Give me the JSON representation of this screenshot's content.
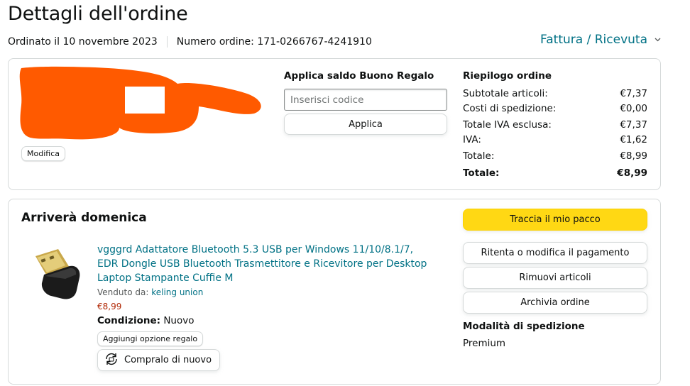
{
  "page": {
    "title": "Dettagli dell'ordine",
    "ordered_on": "Ordinato il 10 novembre 2023",
    "order_number": "Numero ordine: 171-0266767-4241910",
    "invoice_link": "Fattura / Ricevuta"
  },
  "address": {
    "edit_label": "Modifica"
  },
  "gift_card": {
    "title": "Applica saldo Buono Regalo",
    "input_placeholder": "Inserisci codice",
    "input_value": "",
    "apply_label": "Applica"
  },
  "summary": {
    "title": "Riepilogo ordine",
    "rows": [
      {
        "label": "Subtotale articoli:",
        "value": "€7,37"
      },
      {
        "label": "Costi di spedizione:",
        "value": "€0,00"
      },
      {
        "label": "Totale IVA esclusa:",
        "value": "€7,37"
      },
      {
        "label": "IVA:",
        "value": "€1,62"
      },
      {
        "label": "Totale:",
        "value": "€8,99"
      }
    ],
    "grand_total_label": "Totale:",
    "grand_total_value": "€8,99"
  },
  "shipment": {
    "title": "Arriverà domenica",
    "product": {
      "title": "vgggrd Adattatore Bluetooth 5.3 USB per Windows 11/10/8.1/7, EDR Dongle USB Bluetooth Trasmettitore e Ricevitore per Desktop Laptop Stampante Cuffie M",
      "seller_label": "Venduto da:",
      "seller_name": "keling union",
      "price": "€8,99",
      "condition_label": "Condizione:",
      "condition_value": "Nuovo",
      "gift_option_label": "Aggiungi opzione regalo",
      "buy_again_label": "Compralo di nuovo"
    },
    "actions": {
      "track": "Traccia il mio pacco",
      "retry_payment": "Ritenta o modifica il pagamento",
      "remove_items": "Rimuovi articoli",
      "archive": "Archivia ordine"
    },
    "shipping_method_title": "Modalità di spedizione",
    "shipping_method_value": "Premium"
  },
  "colors": {
    "link": "#007185",
    "primary_button": "#ffd814",
    "price": "#b12704",
    "redaction": "#ff5a00"
  },
  "icons": [
    "chevron-down-icon",
    "rebuy-icon"
  ]
}
